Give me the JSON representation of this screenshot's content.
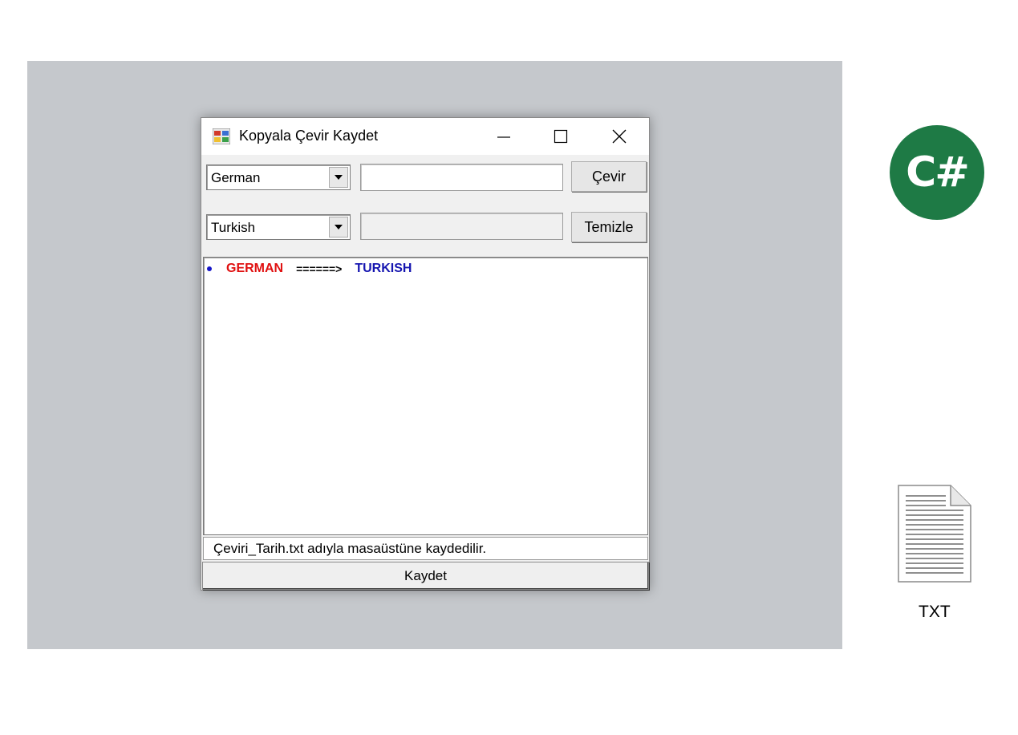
{
  "window": {
    "title": "Kopyala Çevir Kaydet"
  },
  "source": {
    "language": "German",
    "text_value": "",
    "translate_button": "Çevir"
  },
  "target": {
    "language": "Turkish",
    "text_value": "",
    "clear_button": "Temizle"
  },
  "output": {
    "source_label": "GERMAN",
    "arrow": "======>",
    "target_label": "TURKISH"
  },
  "status": {
    "text": "Çeviri_Tarih.txt adıyla masaüstüne kaydedilir."
  },
  "save_button": "Kaydet",
  "side": {
    "logo_text": "C#",
    "file_label": "TXT"
  },
  "colors": {
    "backdrop": "#c5c8cc",
    "source_label": "#e01010",
    "target_label": "#1515b0",
    "logo": "#1e7a45"
  }
}
